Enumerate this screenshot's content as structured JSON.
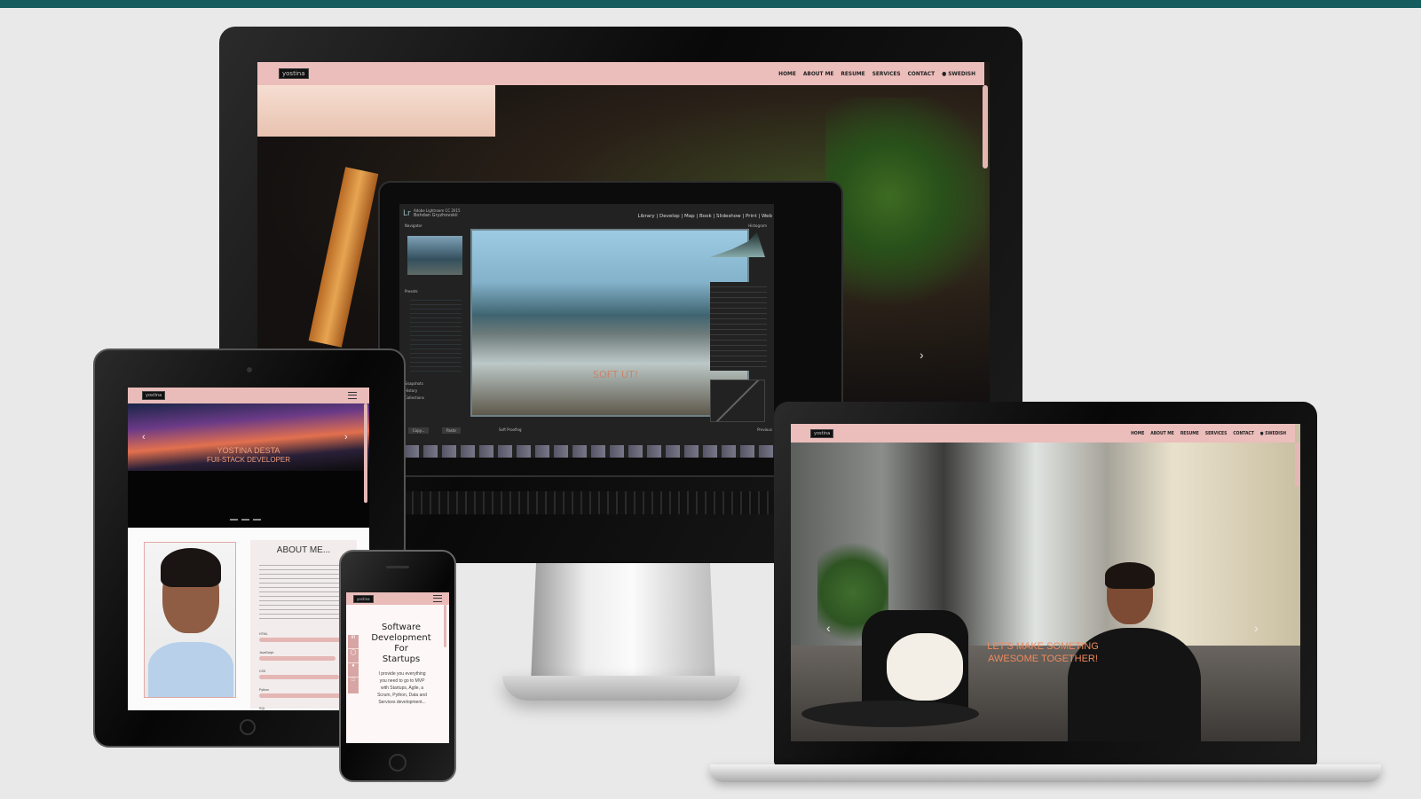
{
  "monitor": {
    "logo": "yostina",
    "nav": [
      "HOME",
      "ABOUT ME",
      "RESUME",
      "SERVICES",
      "CONTACT",
      "SWEDISH"
    ],
    "hero_text": "SOFT UT!",
    "lightroom": {
      "app": "Lr",
      "user_line1": "Adobe Lightroom CC 2015",
      "user_line2": "Bohdan Gryzhovskii",
      "modules": "Library | Develop | Map | Book | Slideshow | Print | Web",
      "panel_left_title": "Navigator",
      "panel_right_title": "Histogram",
      "presets_title": "Presets",
      "snapshots": "Snapshots",
      "history": "History",
      "collections": "Collections",
      "copy": "Copy...",
      "paste": "Paste",
      "soft_proofing": "Soft Proofing",
      "previous": "Previous"
    }
  },
  "laptop": {
    "logo": "yostina",
    "nav": [
      "HOME",
      "ABOUT ME",
      "RESUME",
      "SERVICES",
      "CONTACT",
      "SWEDISH"
    ],
    "hero_line1": "LET'S MAKE SOMETING",
    "hero_line2": "AWESOME TOGETHER!"
  },
  "tablet": {
    "logo": "yostina",
    "hero_name": "YOSTINA DESTA",
    "hero_role": "FUll-STACK DEVELOPER",
    "about_title": "ABOUT ME...",
    "skills": [
      "HTML",
      "JavaScript",
      "CSS",
      "Python",
      "SQL"
    ]
  },
  "phone": {
    "logo": "yostina",
    "title_line1": "Software",
    "title_line2": "Development",
    "title_line3": "For",
    "title_line4": "Startups",
    "body": "I provide you everything you need to go to MVP with Startups, Agile, a Scrum, Python, Data and Services development..."
  },
  "colors": {
    "accent_pink": "#e4b7b5",
    "teal_bar": "#155c5e",
    "hero_text": "#f08a5d"
  }
}
